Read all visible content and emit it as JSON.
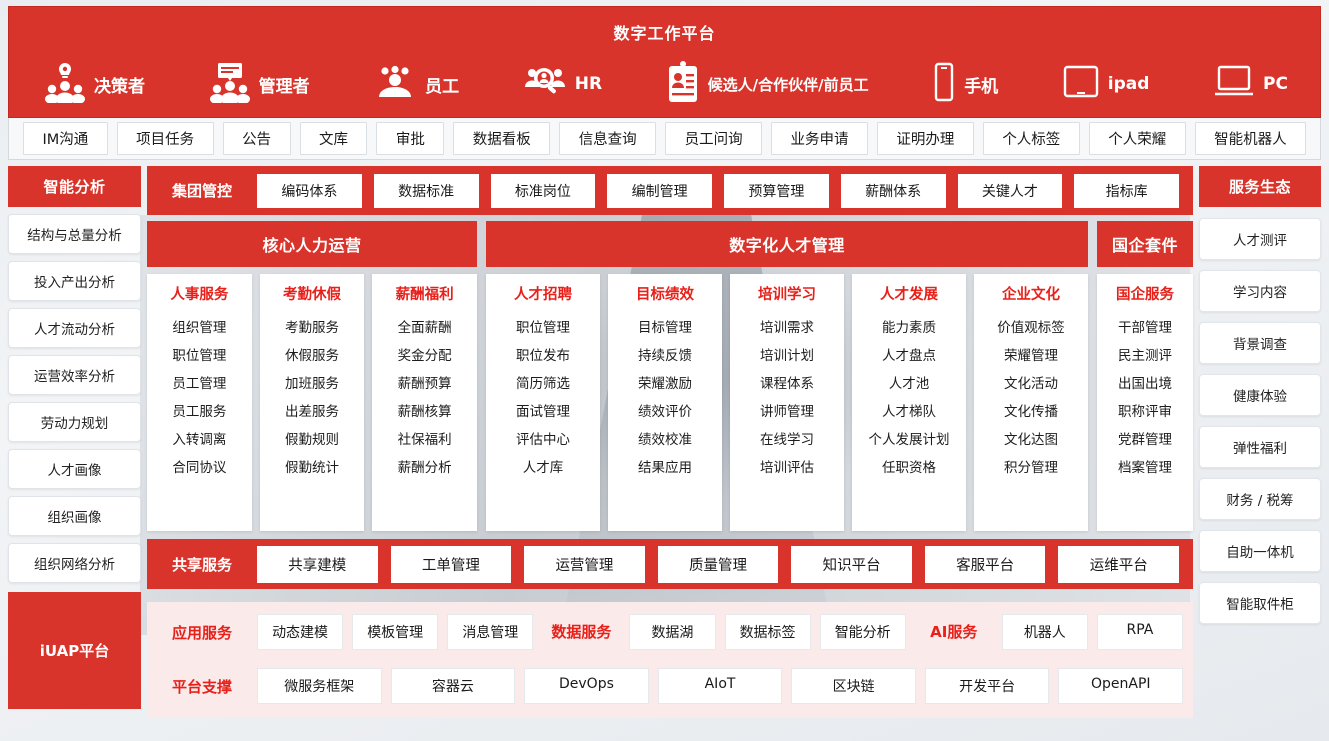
{
  "header": {
    "title": "数字工作平台",
    "personas": [
      {
        "icon": "decision-maker-icon",
        "label": "决策者"
      },
      {
        "icon": "manager-icon",
        "label": "管理者"
      },
      {
        "icon": "employee-icon",
        "label": "员工"
      },
      {
        "icon": "hr-icon",
        "label": "HR"
      },
      {
        "icon": "badge-icon",
        "label": "候选人/合作伙伴/前员工"
      },
      {
        "icon": "phone-icon",
        "label": "手机"
      },
      {
        "icon": "ipad-icon",
        "label": "ipad"
      },
      {
        "icon": "pc-icon",
        "label": "PC"
      }
    ]
  },
  "navbar": {
    "items": [
      "IM沟通",
      "项目任务",
      "公告",
      "文库",
      "审批",
      "数据看板",
      "信息查询",
      "员工问询",
      "业务申请",
      "证明办理",
      "个人标签",
      "个人荣耀",
      "智能机器人"
    ]
  },
  "left_sidebar": {
    "title": "智能分析",
    "items": [
      "结构与总量分析",
      "投入产出分析",
      "人才流动分析",
      "运营效率分析",
      "劳动力规划",
      "人才画像",
      "组织画像",
      "组织网络分析"
    ],
    "platform_label": "iUAP平台"
  },
  "group_control": {
    "title": "集团管控",
    "items": [
      "编码体系",
      "数据标准",
      "标准岗位",
      "编制管理",
      "预算管理",
      "薪酬体系",
      "关键人才",
      "指标库"
    ]
  },
  "core_hr": {
    "title": "核心人力运营",
    "columns": [
      {
        "title": "人事服务",
        "items": [
          "组织管理",
          "职位管理",
          "员工管理",
          "员工服务",
          "入转调离",
          "合同协议"
        ]
      },
      {
        "title": "考勤休假",
        "items": [
          "考勤服务",
          "休假服务",
          "加班服务",
          "出差服务",
          "假勤规则",
          "假勤统计"
        ]
      },
      {
        "title": "薪酬福利",
        "items": [
          "全面薪酬",
          "奖金分配",
          "薪酬预算",
          "薪酬核算",
          "社保福利",
          "薪酬分析"
        ]
      }
    ]
  },
  "talent_mgmt": {
    "title": "数字化人才管理",
    "columns": [
      {
        "title": "人才招聘",
        "items": [
          "职位管理",
          "职位发布",
          "简历筛选",
          "面试管理",
          "评估中心",
          "人才库"
        ]
      },
      {
        "title": "目标绩效",
        "items": [
          "目标管理",
          "持续反馈",
          "荣耀激励",
          "绩效评价",
          "绩效校准",
          "结果应用"
        ]
      },
      {
        "title": "培训学习",
        "items": [
          "培训需求",
          "培训计划",
          "课程体系",
          "讲师管理",
          "在线学习",
          "培训评估"
        ]
      },
      {
        "title": "人才发展",
        "items": [
          "能力素质",
          "人才盘点",
          "人才池",
          "人才梯队",
          "个人发展计划",
          "任职资格"
        ]
      },
      {
        "title": "企业文化",
        "items": [
          "价值观标签",
          "荣耀管理",
          "文化活动",
          "文化传播",
          "文化达图",
          "积分管理"
        ]
      }
    ]
  },
  "soe_suite": {
    "title": "国企套件",
    "columns": [
      {
        "title": "国企服务",
        "items": [
          "干部管理",
          "民主测评",
          "出国出境",
          "职称评审",
          "党群管理",
          "档案管理"
        ]
      }
    ]
  },
  "shared_service": {
    "title": "共享服务",
    "items": [
      "共享建模",
      "工单管理",
      "运营管理",
      "质量管理",
      "知识平台",
      "客服平台",
      "运维平台"
    ]
  },
  "platform": {
    "rows": [
      {
        "groups": [
          {
            "label": "应用服务",
            "items": [
              "动态建模",
              "模板管理",
              "消息管理"
            ]
          },
          {
            "label": "数据服务",
            "items": [
              "数据湖",
              "数据标签",
              "智能分析"
            ]
          },
          {
            "label": "AI服务",
            "items": [
              "机器人",
              "RPA"
            ]
          }
        ]
      },
      {
        "groups": [
          {
            "label": "平台支撑",
            "items": [
              "微服务框架",
              "容器云",
              "DevOps",
              "AIoT",
              "区块链",
              "开发平台",
              "OpenAPI"
            ]
          }
        ]
      }
    ]
  },
  "right_sidebar": {
    "title": "服务生态",
    "items": [
      "人才测评",
      "学习内容",
      "背景调查",
      "健康体验",
      "弹性福利",
      "财务 / 税筹",
      "自助一体机",
      "智能取件柜"
    ]
  },
  "colors": {
    "brand_red": "#d9342b",
    "accent_red": "#e8201a",
    "panel_bg": "#ffffff",
    "page_bg": "#eef1f4"
  }
}
